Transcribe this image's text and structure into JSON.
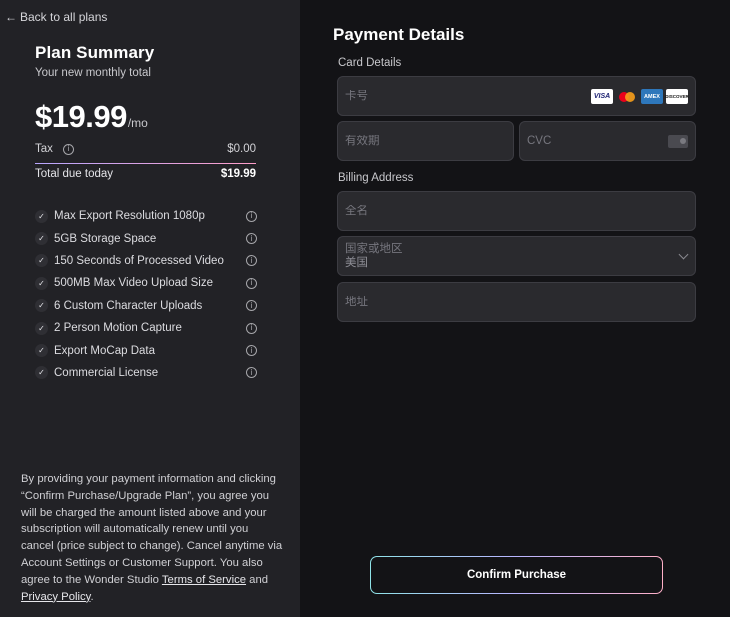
{
  "summary": {
    "back_label": "Back to all plans",
    "title": "Plan Summary",
    "subtitle": "Your new monthly total",
    "price": "$19.99",
    "period": "/mo",
    "tax_label": "Tax",
    "tax_value": "$0.00",
    "total_label": "Total due today",
    "total_value": "$19.99",
    "features": [
      {
        "label": "Max Export Resolution 1080p"
      },
      {
        "label": "5GB Storage Space"
      },
      {
        "label": "150 Seconds of Processed Video"
      },
      {
        "label": "500MB Max Video Upload Size"
      },
      {
        "label": "6 Custom Character Uploads"
      },
      {
        "label": "2 Person Motion Capture"
      },
      {
        "label": "Export MoCap Data"
      },
      {
        "label": "Commercial License"
      }
    ],
    "legal": {
      "text": "By providing your payment information and clicking “Confirm Purchase/Upgrade Plan”, you agree you will be charged the amount listed above and your subscription will automatically renew until you cancel (price subject to change). Cancel anytime via Account Settings or Customer Support. You also agree to the Wonder Studio ",
      "tos_link": "Terms of Service",
      "and": " and ",
      "privacy_link": "Privacy Policy",
      "end": "."
    }
  },
  "payment": {
    "title": "Payment Details",
    "card_section_label": "Card Details",
    "card_number_placeholder": "卡号",
    "expiry_placeholder": "有效期",
    "cvc_placeholder": "CVC",
    "card_logos": {
      "visa": "VISA",
      "amex": "AMEX",
      "discover": "DISCOVER"
    },
    "billing_section_label": "Billing Address",
    "full_name_placeholder": "全名",
    "country_label": "国家或地区",
    "country_value": "美国",
    "address_placeholder": "地址",
    "confirm_label": "Confirm Purchase"
  },
  "colors": {
    "left_panel_bg": "#222226",
    "right_panel_bg": "#131316",
    "field_bg": "#2a2a2e",
    "accent_gradient_start": "#8fe3e8",
    "accent_gradient_mid": "#b8b4ff",
    "accent_gradient_end": "#ffb0c8"
  }
}
